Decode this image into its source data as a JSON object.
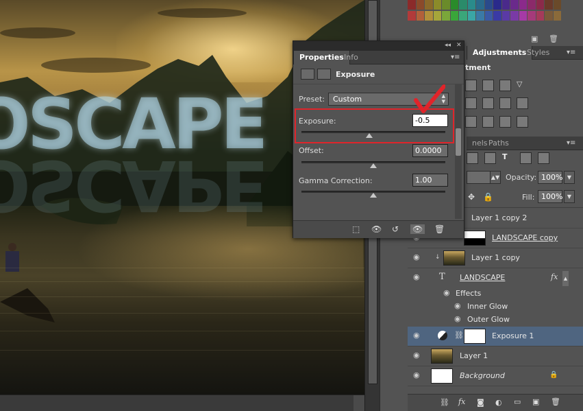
{
  "canvas": {
    "overlay_text": "OSCAPE"
  },
  "properties_panel": {
    "tabs": [
      "Properties",
      "Info"
    ],
    "active_tab": "Properties",
    "adjustment_title": "Exposure",
    "preset_label": "Preset:",
    "preset_value": "Custom",
    "fields": [
      {
        "label": "Exposure:",
        "value": "-0.5",
        "slider_fraction": 0.47
      },
      {
        "label": "Offset:",
        "value": "0.0000",
        "slider_fraction": 0.5
      },
      {
        "label": "Gamma Correction:",
        "value": "1.00",
        "slider_fraction": 0.5
      }
    ],
    "highlight_color": "#e0242a",
    "footer_icons": [
      "clip-to-layer-icon",
      "view-previous-icon",
      "reset-icon",
      "visibility-icon",
      "delete-icon"
    ]
  },
  "adjustments_panel": {
    "tabs": [
      "Adjustments",
      "Styles"
    ],
    "heading_partial": "tment"
  },
  "layers_panel": {
    "tabs": [
      "nels",
      "Paths"
    ],
    "opacity_label": "Opacity:",
    "opacity_value": "100%",
    "fill_label": "Fill:",
    "fill_value": "100%",
    "layers": [
      {
        "name": "Layer 1 copy 2",
        "thumb": "none",
        "style": "normal"
      },
      {
        "name": "LANDSCAPE copy",
        "thumb": "mask",
        "style": "underline"
      },
      {
        "name": "Layer 1 copy",
        "thumb": "photo",
        "style": "normal"
      },
      {
        "name": "LANDSCAPE",
        "thumb": "text",
        "style": "underline"
      },
      {
        "name": "Exposure 1",
        "thumb": "white",
        "style": "normal",
        "selected": true
      },
      {
        "name": "Layer 1",
        "thumb": "photo",
        "style": "normal"
      },
      {
        "name": "Background",
        "thumb": "white",
        "style": "italic",
        "locked": true
      }
    ],
    "effects": {
      "label": "Effects",
      "items": [
        "Inner Glow",
        "Outer Glow"
      ]
    },
    "fx_label": "fx"
  },
  "colors": {
    "panel_bg": "#535353",
    "selected_layer": "#4f6580",
    "highlight_red": "#e0242a"
  }
}
